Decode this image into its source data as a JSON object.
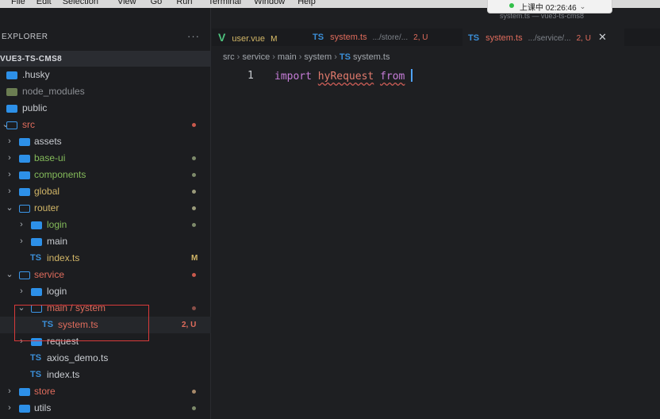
{
  "menu_bar": {
    "items": [
      "File",
      "Edit",
      "Selection",
      "View",
      "Go",
      "Run",
      "Terminal",
      "Window",
      "Help"
    ],
    "recording_status": "上课中 02:26:46"
  },
  "window_title": "system.ts — vue3-ts-cms8",
  "explorer": {
    "title": "EXPLORER",
    "more": "···",
    "project": "VUE3-TS-CMS8",
    "items": [
      {
        "label": ".husky"
      },
      {
        "label": "node_modules"
      },
      {
        "label": "public"
      },
      {
        "label": "src"
      },
      {
        "label": "assets"
      },
      {
        "label": "base-ui"
      },
      {
        "label": "components"
      },
      {
        "label": "global"
      },
      {
        "label": "router"
      },
      {
        "label": "login"
      },
      {
        "label": "main"
      },
      {
        "label": "index.ts",
        "status": "M"
      },
      {
        "label": "service"
      },
      {
        "label": "login"
      },
      {
        "label": "main / system"
      },
      {
        "label": "system.ts",
        "status": "2, U"
      },
      {
        "label": "request"
      },
      {
        "label": "axios_demo.ts"
      },
      {
        "label": "index.ts"
      },
      {
        "label": "store"
      },
      {
        "label": "utils"
      }
    ]
  },
  "tabs": [
    {
      "icon": "V",
      "label": "user.vue",
      "status": "M"
    },
    {
      "icon": "TS",
      "label": "system.ts",
      "path": ".../store/...",
      "status": "2, U"
    },
    {
      "icon": "TS",
      "label": "system.ts",
      "path": ".../service/...",
      "status": "2, U",
      "close": "✕"
    }
  ],
  "breadcrumb": {
    "parts": [
      "src",
      "service",
      "main",
      "system"
    ],
    "ts_icon": "TS",
    "file": "system.ts"
  },
  "editor": {
    "line_number": "1",
    "keyword_import": "import",
    "identifier": "hyRequest",
    "keyword_from": "from"
  },
  "colors": {
    "accent_blue": "#2d90e8",
    "modified_yellow": "#d2b667",
    "untracked_green": "#84bb5a",
    "error_red": "#e06c5c",
    "highlight_box": "#d83a3a"
  }
}
